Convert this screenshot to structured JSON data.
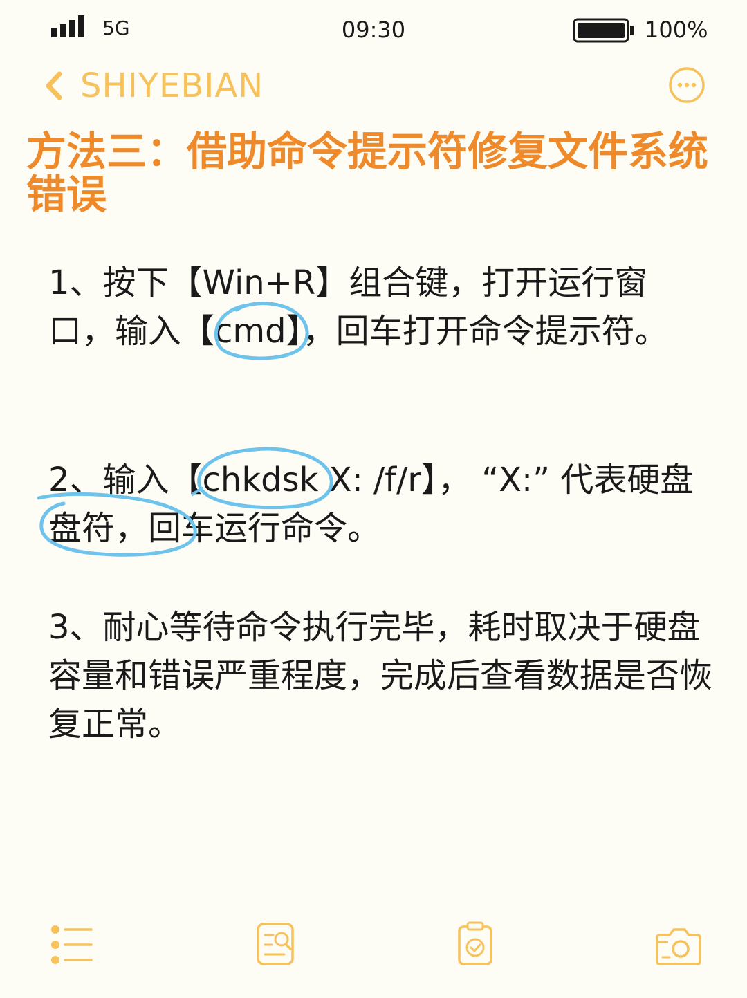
{
  "status_bar": {
    "network": "5G",
    "time": "09:30",
    "battery": "100%"
  },
  "nav": {
    "back_label": "SHIYEBIAN"
  },
  "title": "方法三：借助命令提示符修复文件系统错误",
  "paragraphs": [
    "1、按下【Win+R】组合键，打开运行窗口，输入【cmd】，回车打开命令提示符。",
    "2、输入【chkdsk X: /f/r】， “X:” 代表硬盘盘符，回车运行命令。",
    "3、耐心等待命令执行完毕，耗时取决于硬盘容量和错误严重程度，完成后查看数据是否恢复正常。"
  ],
  "toolbar_icons": [
    "list-icon",
    "search-document-icon",
    "clipboard-check-icon",
    "camera-icon"
  ],
  "colors": {
    "accent": "#f7c15b",
    "title": "#ef8a2b",
    "annotation": "#6ec3ec",
    "background": "#fdfcf5"
  }
}
